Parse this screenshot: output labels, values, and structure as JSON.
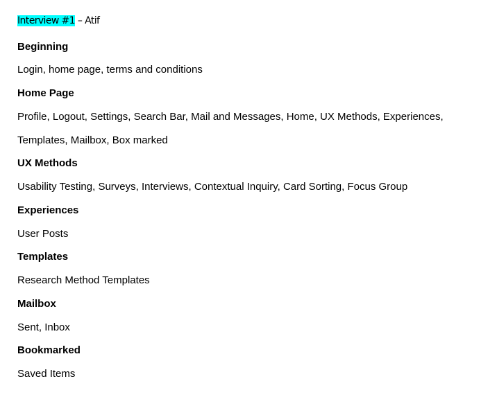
{
  "title": {
    "highlighted": "Interview #1",
    "rest": " – Atif",
    "highlight_color": "#00ffff"
  },
  "sections": [
    {
      "heading": "Beginning",
      "lines": [
        "Login, home page, terms and conditions"
      ]
    },
    {
      "heading": "Home Page",
      "lines": [
        "Profile, Logout, Settings, Search Bar, Mail and Messages, Home, UX Methods, Experiences,",
        "Templates, Mailbox, Box marked"
      ]
    },
    {
      "heading": "UX Methods",
      "lines": [
        "Usability Testing, Surveys, Interviews, Contextual Inquiry, Card Sorting, Focus Group"
      ]
    },
    {
      "heading": "Experiences",
      "lines": [
        "User Posts"
      ]
    },
    {
      "heading": "Templates",
      "lines": [
        "Research Method Templates"
      ]
    },
    {
      "heading": "Mailbox",
      "lines": [
        "Sent, Inbox"
      ]
    },
    {
      "heading": "Bookmarked",
      "lines": [
        "Saved Items"
      ]
    }
  ]
}
